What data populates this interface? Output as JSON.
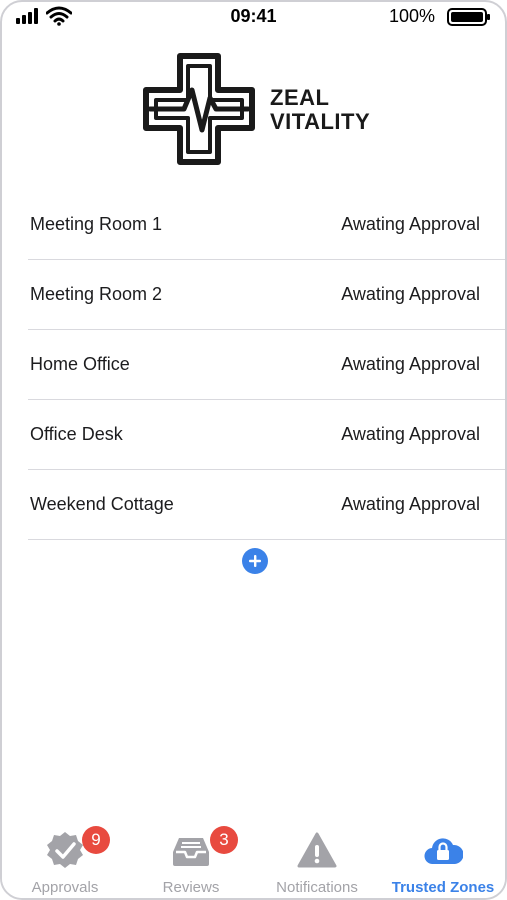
{
  "status_bar": {
    "time": "09:41",
    "battery_percent": "100%"
  },
  "logo": {
    "line1": "ZEAL",
    "line2": "VITALITY"
  },
  "zones": [
    {
      "name": "Meeting Room 1",
      "status": "Awating Approval"
    },
    {
      "name": "Meeting Room 2",
      "status": "Awating Approval"
    },
    {
      "name": "Home Office",
      "status": "Awating Approval"
    },
    {
      "name": "Office Desk",
      "status": "Awating Approval"
    },
    {
      "name": "Weekend Cottage",
      "status": "Awating Approval"
    }
  ],
  "add_button": {
    "icon": "plus-icon"
  },
  "tab_bar": {
    "tabs": [
      {
        "label": "Approvals",
        "icon": "check-badge-icon",
        "badge": "9",
        "active": false
      },
      {
        "label": "Reviews",
        "icon": "inbox-tray-icon",
        "badge": "3",
        "active": false
      },
      {
        "label": "Notifications",
        "icon": "warning-triangle-icon",
        "badge": "",
        "active": false
      },
      {
        "label": "Trusted Zones",
        "icon": "cloud-lock-icon",
        "badge": "",
        "active": true
      }
    ]
  },
  "colors": {
    "accent": "#3b82e8",
    "badge": "#e84a3f",
    "inactive": "#a3a3a8"
  }
}
